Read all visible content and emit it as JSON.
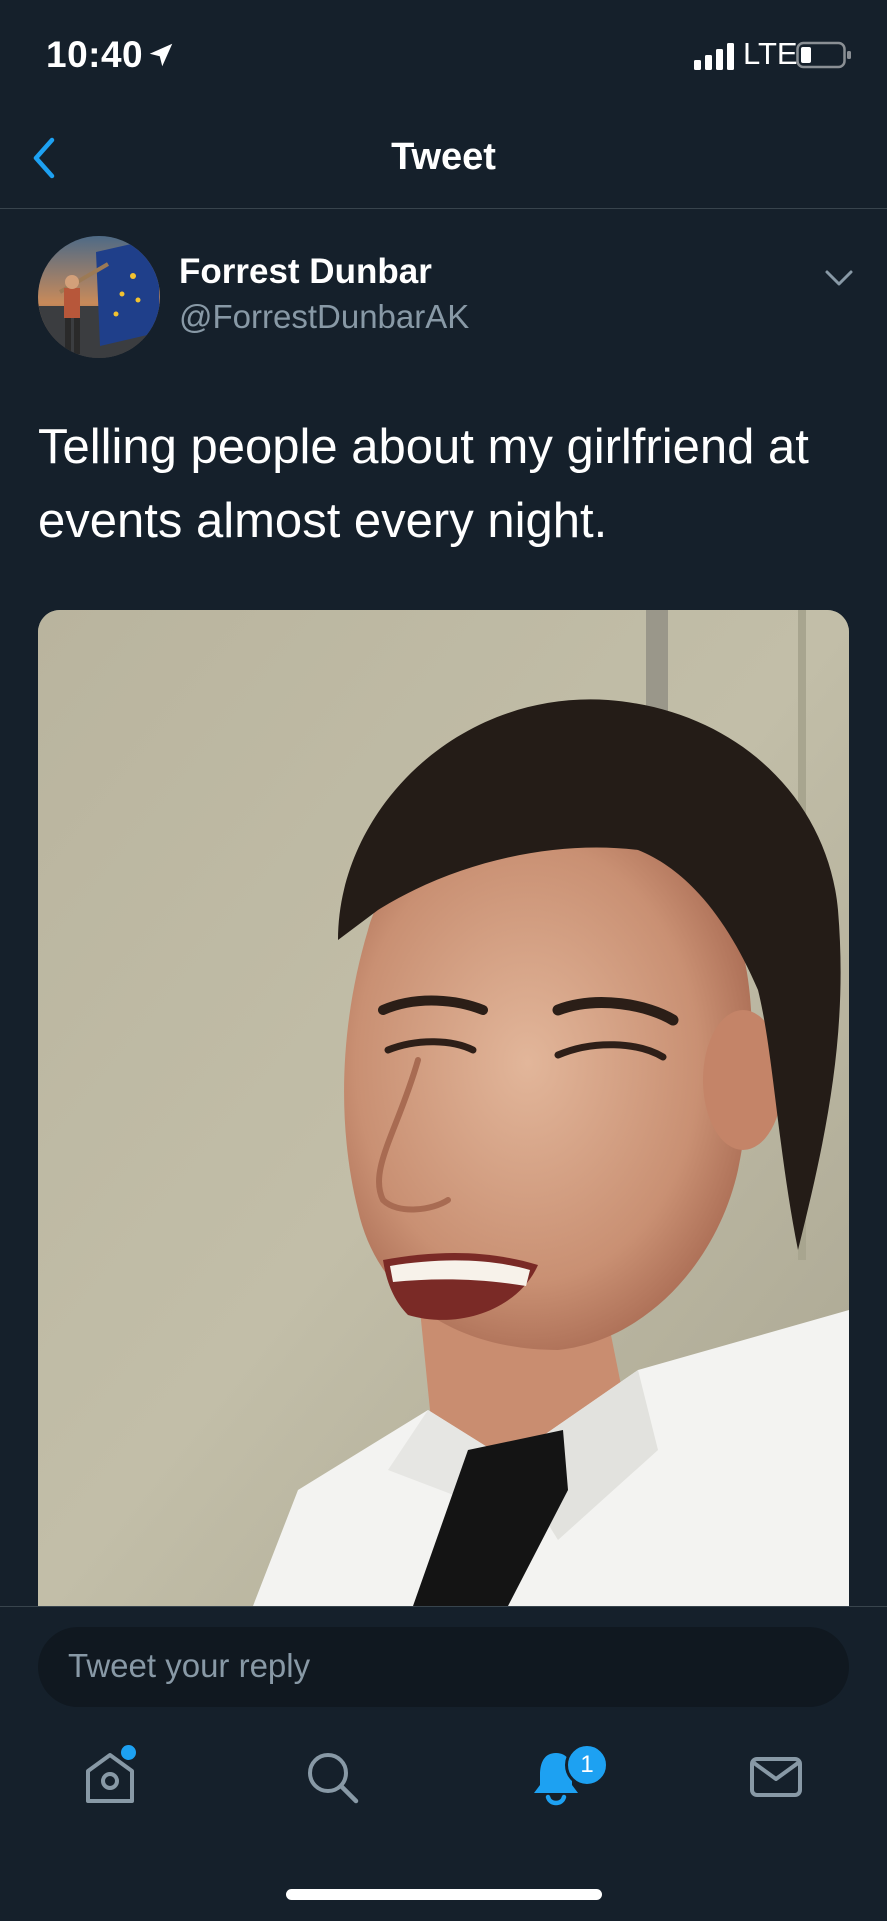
{
  "status_bar": {
    "time": "10:40",
    "network": "LTE"
  },
  "nav": {
    "title": "Tweet"
  },
  "tweet": {
    "author_name": "Forrest Dunbar",
    "author_handle": "@ForrestDunbarAK",
    "text": "Telling people about my girlfriend at events almost every night."
  },
  "reply": {
    "placeholder": "Tweet your reply"
  },
  "tab_bar": {
    "items": [
      "home",
      "search",
      "notifications",
      "messages"
    ],
    "notification_count": "1"
  },
  "colors": {
    "background": "#15202b",
    "accent": "#1da1f2",
    "secondary_text": "#8899a6",
    "divider": "#38444d"
  },
  "icons": [
    "location-arrow-icon",
    "signal-icon",
    "battery-icon",
    "back-chevron-icon",
    "chevron-down-icon",
    "home-icon",
    "search-icon",
    "bell-icon",
    "mail-icon"
  ]
}
